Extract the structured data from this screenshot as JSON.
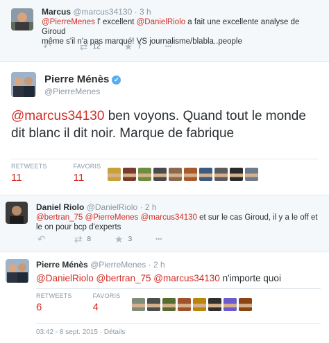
{
  "tweet1": {
    "name": "Marcus",
    "handle": "@marcus34130",
    "time": "· 3 h",
    "text_parts": [
      "@PierreMenes",
      " l' excellent ",
      "@DanielRiolo",
      "  a fait une excellente analyse de Giroud",
      "même s'il n'a pas marqué! VS  journalisme/blabla..people"
    ],
    "retweet_count": "12",
    "favorite_count": "7"
  },
  "tweet2": {
    "name": "Pierre Ménès",
    "handle": "@PierreMenes",
    "verified_icon": "✔",
    "text_mention": "@marcus34130",
    "text_body": " ben voyons. Quand tout le monde dit blanc il dit noir. Marque de fabrique",
    "retweets_label": "RETWEETS",
    "retweets_value": "11",
    "favorites_label": "FAVORIS",
    "favorites_value": "11"
  },
  "tweet3": {
    "name": "Daniel Riolo",
    "handle": "@DanielRiolo",
    "time": "· 2 h",
    "text_parts": [
      "@bertran_75",
      " ",
      "@PierreMenes",
      " ",
      "@marcus34130",
      " et sur le cas Giroud, il y a le off et",
      "le on pour bcp d'experts"
    ],
    "retweet_count": "8",
    "favorite_count": "3"
  },
  "tweet4": {
    "name": "Pierre Ménès",
    "handle": "@PierreMenes",
    "time": "· 2 h",
    "text_parts": [
      "@DanielRiolo",
      " ",
      "@bertran_75",
      " ",
      "@marcus34130",
      " n'importe quoi"
    ],
    "retweets_label": "RETWEETS",
    "retweets_value": "6",
    "favorites_label": "FAVORIS",
    "favorites_value": "4",
    "timestamp": "03:42 - 8 sept. 2015",
    "details_link": "Détails"
  },
  "icons": {
    "reply": "↶",
    "retweet": "⇄",
    "favorite": "★",
    "more": "•••"
  },
  "colors": {
    "accent": "#d12c25",
    "meta": "#8899a6",
    "verified": "#55acee",
    "reply_bg": "#f5f8fa"
  },
  "face_colors_1": [
    "#c9a13b",
    "#7a3b2e",
    "#6b8f3e",
    "#4a4a4a",
    "#8c6a4f",
    "#a85a2c",
    "#3d5a80",
    "#5c5c5c",
    "#2b2b2b",
    "#6e7b8b"
  ],
  "face_colors_2": [
    "#7f8c7a",
    "#4d4d4d",
    "#556b2f",
    "#a0522d",
    "#b8860b",
    "#2f2f2f",
    "#6a5acd",
    "#8b4513"
  ]
}
